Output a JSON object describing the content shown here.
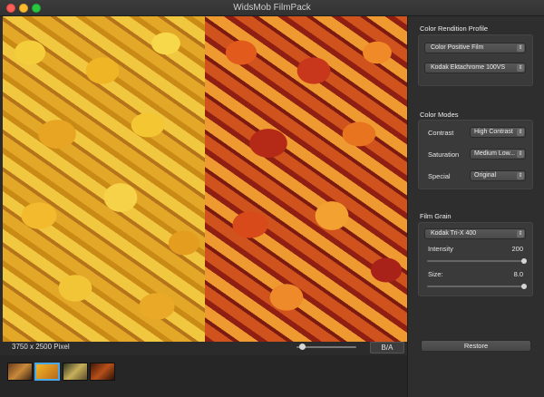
{
  "window": {
    "title": "WidsMob FilmPack"
  },
  "preview": {
    "pixel_size": "3750 x 2500 Pixel",
    "zoom_level": 0.05,
    "compare_label": "B/A"
  },
  "filmstrip": {
    "thumbnails": [
      "thumbnail-1",
      "thumbnail-2",
      "thumbnail-3",
      "thumbnail-4"
    ],
    "selected_index": 1
  },
  "sidebar": {
    "color_rendition": {
      "title": "Color Rendition Profile",
      "profile": "Color Positive Film",
      "film": "Kodak Ektachrome 100VS"
    },
    "color_modes": {
      "title": "Color Modes",
      "contrast_label": "Contrast",
      "contrast_value": "High Contrast",
      "saturation_label": "Saturation",
      "saturation_value": "Medium Low...",
      "special_label": "Special",
      "special_value": "Original"
    },
    "film_grain": {
      "title": "Film Grain",
      "film": "Kodak Tri-X 400",
      "intensity_label": "Intensity",
      "intensity_value": "200",
      "size_label": "Size:",
      "size_value": "8.0"
    },
    "restore_label": "Restore"
  }
}
